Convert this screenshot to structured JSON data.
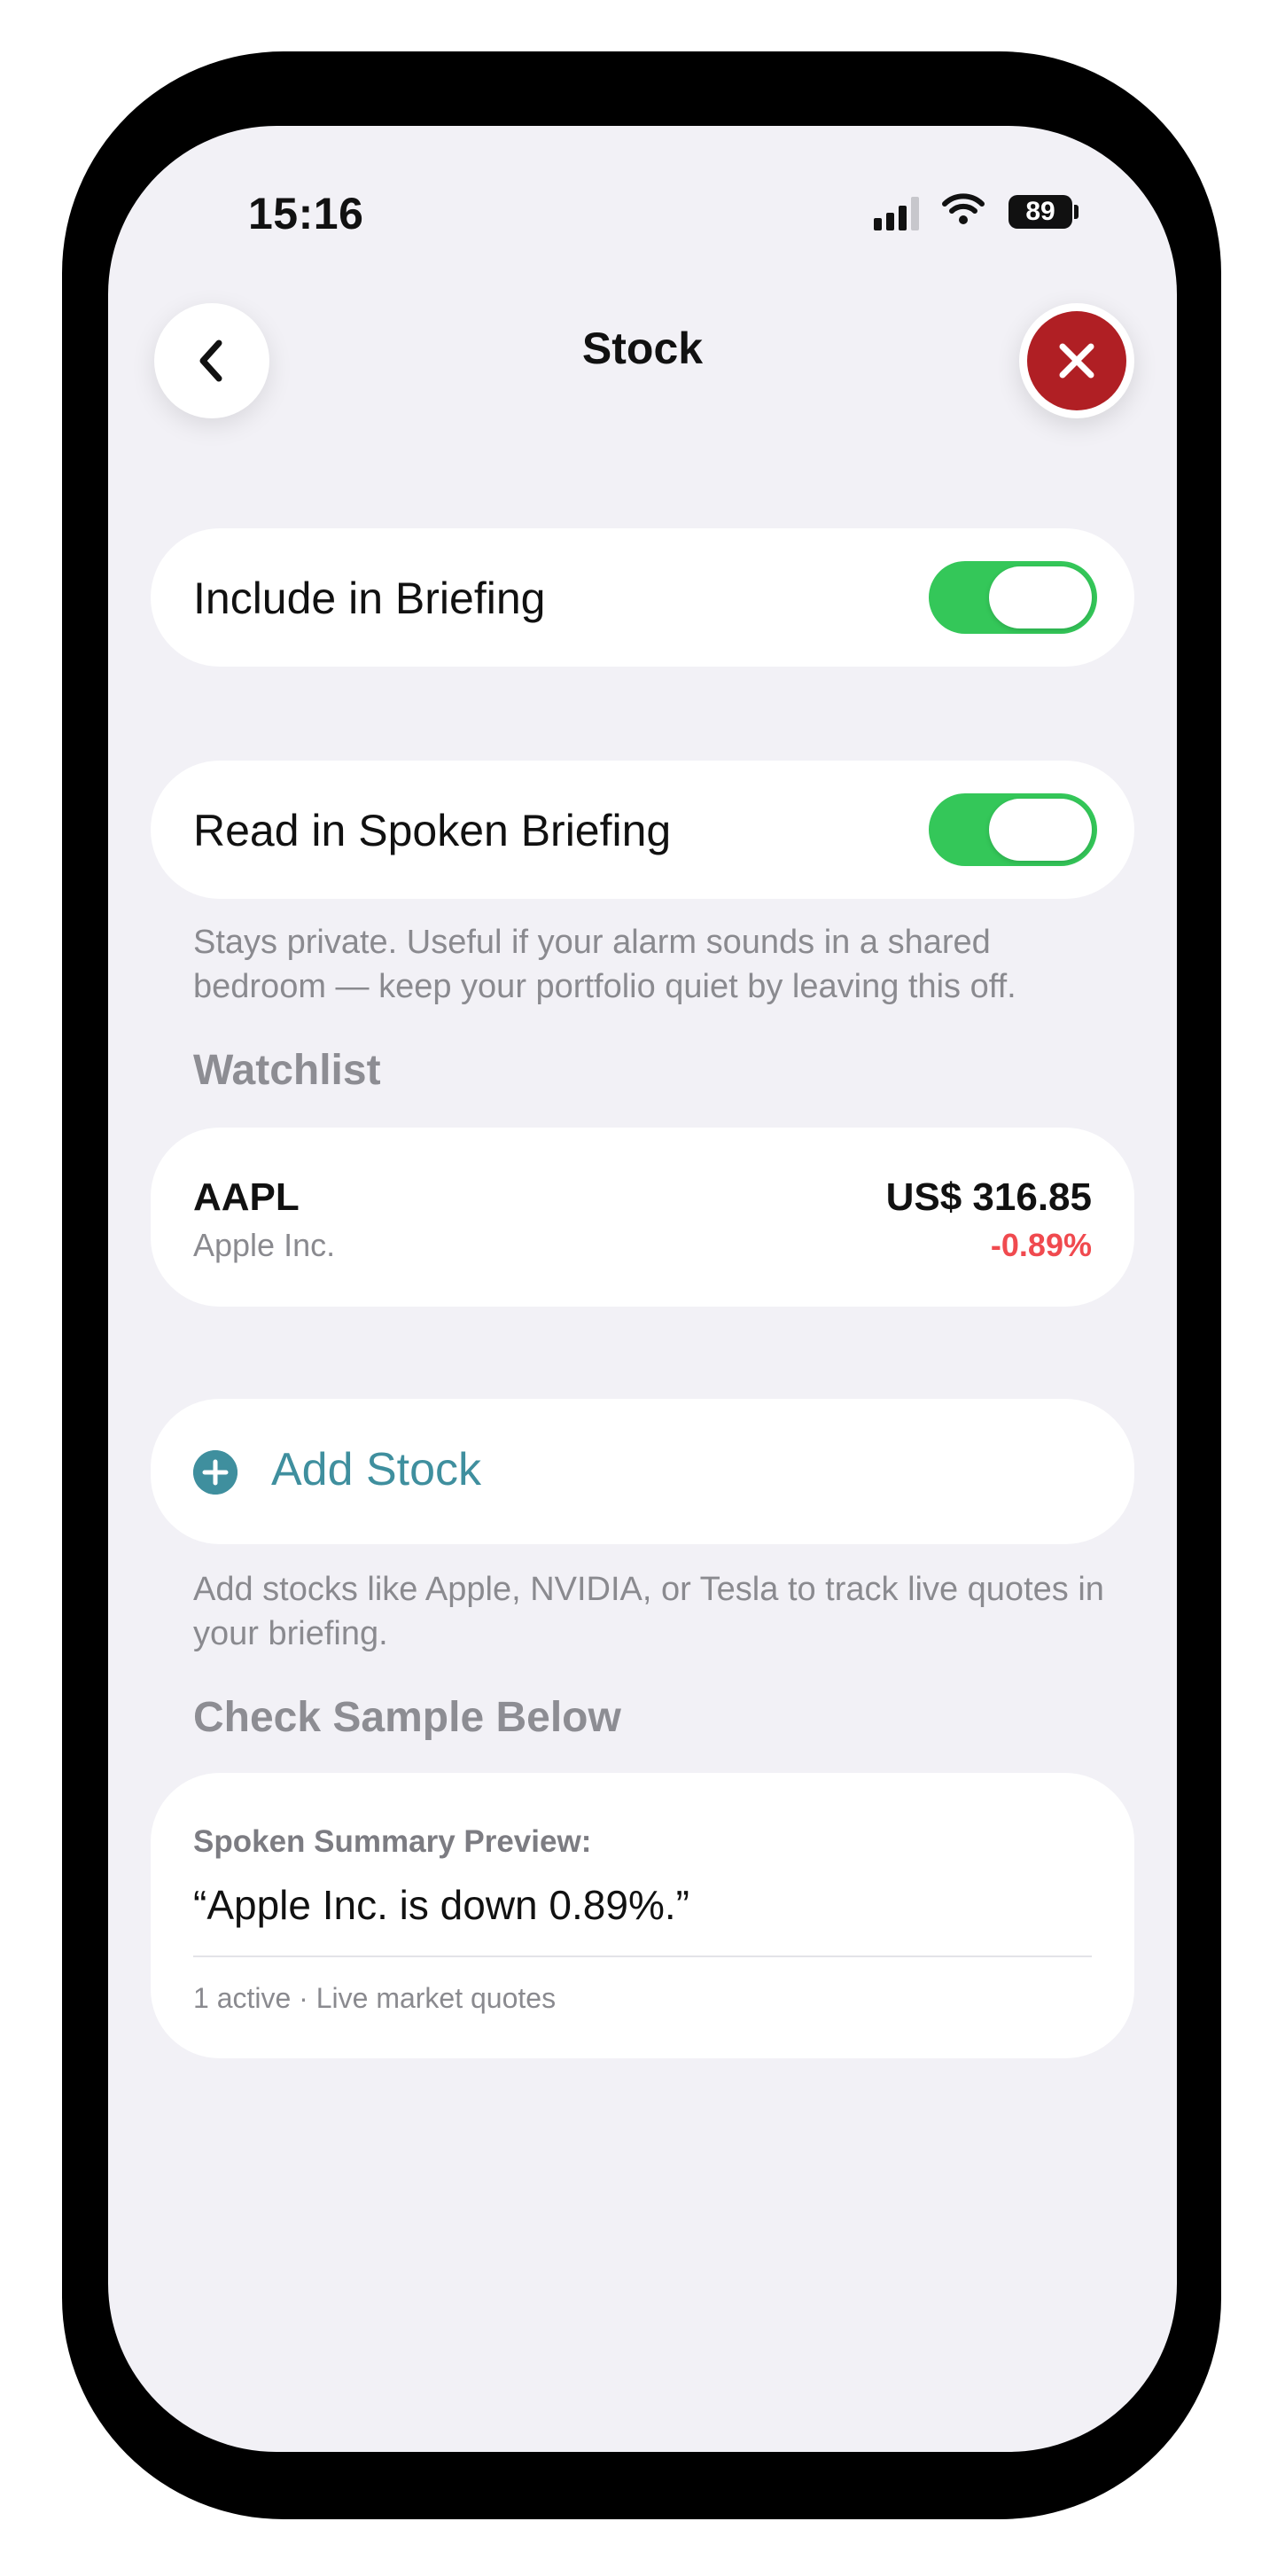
{
  "status_bar": {
    "time": "15:16",
    "battery": "89"
  },
  "header": {
    "title": "Stock",
    "back_icon": "chevron-left-icon",
    "close_icon": "close-icon",
    "close_color": "#b01f24"
  },
  "settings": {
    "include_in_briefing": {
      "label": "Include in Briefing",
      "enabled": true
    },
    "read_in_spoken_briefing": {
      "label": "Read in Spoken Briefing",
      "enabled": true,
      "footnote": "Stays private. Useful if your alarm sounds in a shared bedroom — keep your portfolio quiet by leaving this off."
    },
    "toggle_color": "#34c759"
  },
  "watchlist": {
    "header": "Watchlist",
    "items": [
      {
        "ticker": "AAPL",
        "name": "Apple Inc.",
        "price": "US$ 316.85",
        "change": "-0.89%",
        "change_color": "#f04a4f"
      }
    ]
  },
  "add_stock": {
    "label": "Add Stock",
    "icon": "plus-circle-icon",
    "accent": "#3f8f9e",
    "footnote": "Add stocks like Apple, NVIDIA, or Tesla to track live quotes in your briefing."
  },
  "sample": {
    "header": "Check Sample Below",
    "preview_label": "Spoken Summary Preview:",
    "preview_text": "“Apple Inc. is down 0.89%.”",
    "meta": "1 active · Live market quotes"
  }
}
